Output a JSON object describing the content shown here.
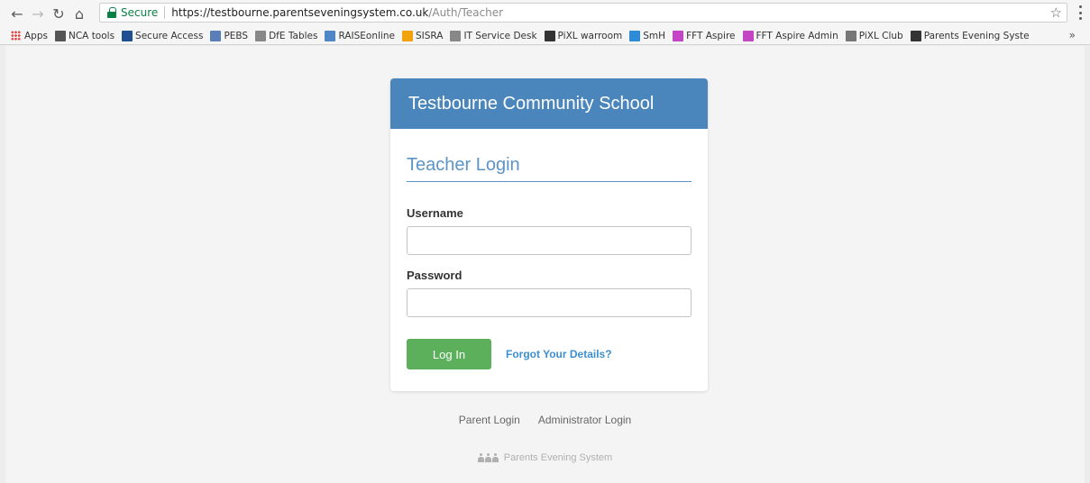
{
  "browser": {
    "secure_label": "Secure",
    "url_host": "https://testbourne.parentseveningsystem.co.uk",
    "url_path": "/Auth/Teacher",
    "bookmarks": [
      {
        "label": "Apps",
        "icon": "apps-grid-icon"
      },
      {
        "label": "NCA tools",
        "icon": "crest-icon",
        "color": "#555555"
      },
      {
        "label": "Secure Access",
        "icon": "dfe-icon",
        "color": "#1d4f91"
      },
      {
        "label": "PEBS",
        "icon": "people-icon",
        "color": "#5a7fb8"
      },
      {
        "label": "DfE Tables",
        "icon": "page-icon",
        "color": "#888888"
      },
      {
        "label": "RAISEonline",
        "icon": "ro-icon",
        "color": "#4f86c6"
      },
      {
        "label": "SISRA",
        "icon": "sisra-icon",
        "color": "#f2a20c"
      },
      {
        "label": "IT Service Desk",
        "icon": "page-icon",
        "color": "#888888"
      },
      {
        "label": "PiXL warroom",
        "icon": "pixl-icon",
        "color": "#333333"
      },
      {
        "label": "SmH",
        "icon": "smh-icon",
        "color": "#2e8bd8"
      },
      {
        "label": "FFT Aspire",
        "icon": "fft-icon",
        "color": "#c445c4"
      },
      {
        "label": "FFT Aspire Admin",
        "icon": "fft-icon",
        "color": "#c445c4"
      },
      {
        "label": "PiXL Club",
        "icon": "pixl-small-icon",
        "color": "#777777"
      },
      {
        "label": "Parents Evening Syste",
        "icon": "person-icon",
        "color": "#333333"
      }
    ],
    "more_label": "»"
  },
  "card": {
    "school_name": "Testbourne Community School",
    "login_title": "Teacher Login",
    "username_label": "Username",
    "username_value": "",
    "password_label": "Password",
    "password_value": "",
    "login_button": "Log In",
    "forgot_link": "Forgot Your Details?",
    "header_color": "#4a86bc",
    "button_color": "#5cb05c"
  },
  "footer": {
    "parent_login": "Parent Login",
    "admin_login": "Administrator Login",
    "brand": "Parents Evening System"
  }
}
